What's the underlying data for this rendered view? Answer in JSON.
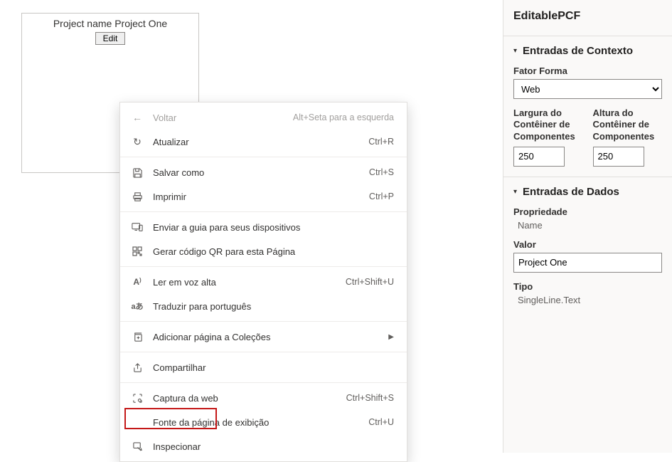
{
  "canvas": {
    "project_text": "Project name Project One",
    "edit_label": "Edit"
  },
  "context_menu": {
    "back": {
      "label": "Voltar",
      "shortcut": "Alt+Seta para a esquerda"
    },
    "refresh": {
      "label": "Atualizar",
      "shortcut": "Ctrl+R"
    },
    "save_as": {
      "label": "Salvar como",
      "shortcut": "Ctrl+S"
    },
    "print": {
      "label": "Imprimir",
      "shortcut": "Ctrl+P"
    },
    "send_tab": {
      "label": "Enviar a guia para seus dispositivos",
      "shortcut": ""
    },
    "qr": {
      "label": "Gerar código QR para esta Página",
      "shortcut": ""
    },
    "read_aloud": {
      "label": "Ler em voz alta",
      "shortcut": "Ctrl+Shift+U"
    },
    "translate": {
      "label": "Traduzir para português",
      "shortcut": ""
    },
    "collections": {
      "label": "Adicionar página a Coleções",
      "shortcut": ""
    },
    "share": {
      "label": "Compartilhar",
      "shortcut": ""
    },
    "web_capture": {
      "label": "Captura da web",
      "shortcut": "Ctrl+Shift+S"
    },
    "view_source": {
      "label": "Fonte da página de exibição",
      "shortcut": "Ctrl+U"
    },
    "inspect": {
      "label": "Inspecionar",
      "shortcut": ""
    }
  },
  "panel": {
    "title": "EditablePCF",
    "section_context_title": "Entradas de Contexto",
    "form_factor_label": "Fator Forma",
    "form_factor_value": "Web",
    "width_label": "Largura do Contêiner de Componentes",
    "width_value": "250",
    "height_label": "Altura do Contêiner de Componentes",
    "height_value": "250",
    "section_data_title": "Entradas de Dados",
    "property_label": "Propriedade",
    "property_value": "Name",
    "value_label": "Valor",
    "value_value": "Project One",
    "type_label": "Tipo",
    "type_value": "SingleLine.Text"
  }
}
